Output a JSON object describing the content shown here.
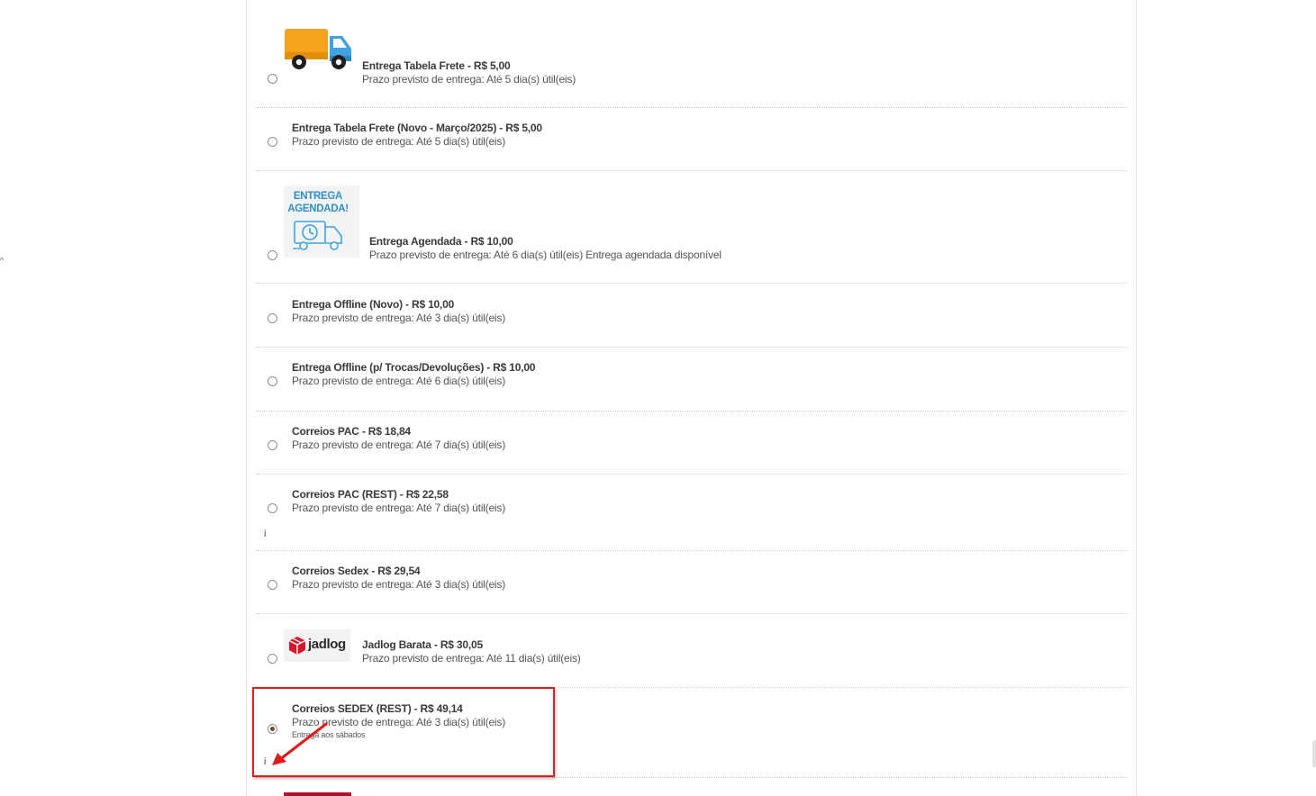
{
  "page": {
    "left_caret": "^"
  },
  "colors": {
    "highlight": "#e11b1b",
    "agendada_blue": "#2f8ec6",
    "truck_orange": "#f5a31c",
    "truck_blue": "#3fa3e0",
    "jadlog_red": "#d9172c",
    "radio_checked": "#6b4b2a"
  },
  "options": [
    {
      "id": "tabela-frete",
      "logo": "truck-icon",
      "title": "Entrega Tabela Frete - R$ 5,00",
      "desc": "Prazo previsto de entrega: Até 5 dia(s) útil(eis)",
      "selected": false
    },
    {
      "id": "tabela-frete-novo",
      "title": "Entrega Tabela Frete (Novo - Março/2025) - R$ 5,00",
      "desc": "Prazo previsto de entrega: Até 5 dia(s) útil(eis)",
      "selected": false
    },
    {
      "id": "agendada",
      "logo": "entrega-agendada-icon",
      "logo_text_1": "ENTREGA",
      "logo_text_2": "AGENDADA!",
      "title": "Entrega Agendada - R$ 10,00",
      "desc": "Prazo previsto de entrega: Até 6 dia(s) útil(eis) Entrega agendada disponível",
      "selected": false
    },
    {
      "id": "offline-novo",
      "title": "Entrega Offline (Novo) - R$ 10,00",
      "desc": "Prazo previsto de entrega: Até 3 dia(s) útil(eis)",
      "selected": false
    },
    {
      "id": "offline-trocas",
      "title": "Entrega Offline (p/ Trocas/Devoluções) - R$ 10,00",
      "desc": "Prazo previsto de entrega: Até 6 dia(s) útil(eis)",
      "selected": false
    },
    {
      "id": "correios-pac",
      "title": "Correios PAC - R$ 18,84",
      "desc": "Prazo previsto de entrega: Até 7 dia(s) útil(eis)",
      "selected": false
    },
    {
      "id": "correios-pac-rest",
      "title": "Correios PAC (REST) - R$ 22,58",
      "desc": "Prazo previsto de entrega: Até 7 dia(s) útil(eis)",
      "info": "i",
      "selected": false
    },
    {
      "id": "correios-sedex",
      "title": "Correios Sedex - R$ 29,54",
      "desc": "Prazo previsto de entrega: Até 3 dia(s) útil(eis)",
      "selected": false
    },
    {
      "id": "jadlog-barata",
      "logo": "jadlog-logo",
      "logo_text": "jadlog",
      "title": "Jadlog Barata - R$ 30,05",
      "desc": "Prazo previsto de entrega: Até 11 dia(s) útil(eis)",
      "selected": false
    },
    {
      "id": "correios-sedex-rest",
      "title": "Correios SEDEX (REST) - R$ 49,14",
      "desc": "Prazo previsto de entrega: Até 3 dia(s) útil(eis)",
      "extra": "Entrega aos sábados",
      "info": "i",
      "selected": true
    }
  ]
}
